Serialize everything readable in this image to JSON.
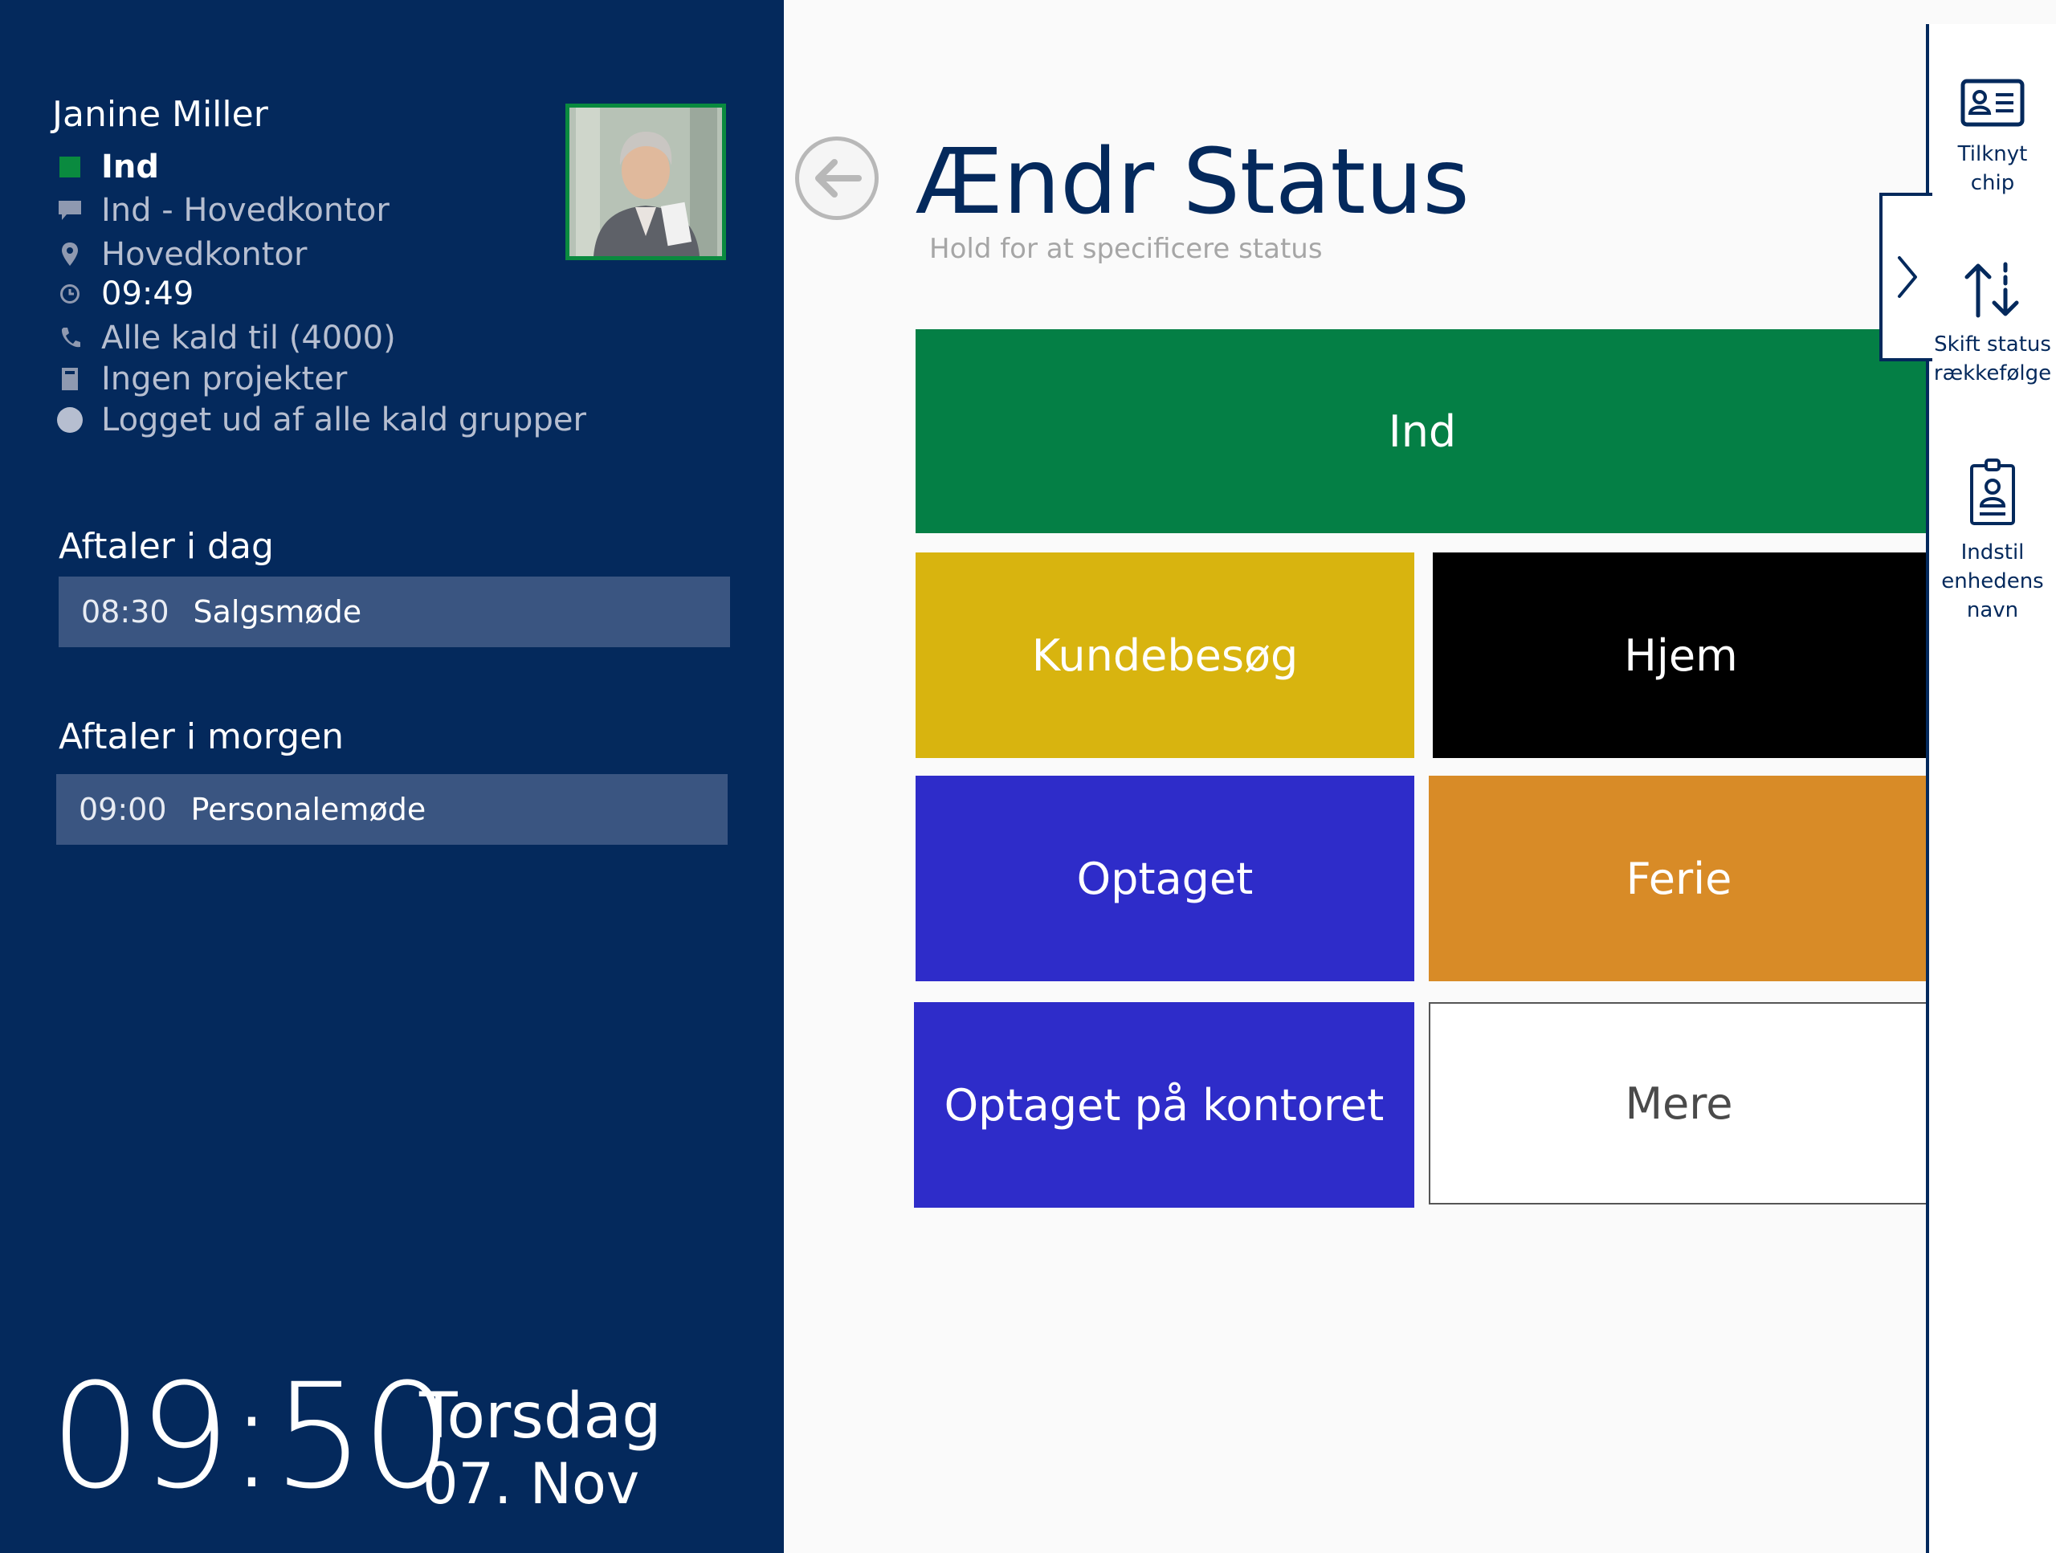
{
  "user": {
    "name": "Janine Miller",
    "status": "Ind",
    "status_color": "#0a8a3f",
    "message": "Ind - Hovedkontor",
    "location": "Hovedkontor",
    "time": "09:49",
    "calls": "Alle kald til (4000)",
    "projects": "Ingen projekter",
    "call_groups": "Logget ud af alle kald grupper"
  },
  "appointments_today": {
    "title": "Aftaler i dag",
    "items": [
      {
        "time": "08:30",
        "label": "Salgsmøde"
      }
    ]
  },
  "appointments_tomorrow": {
    "title": "Aftaler i morgen",
    "items": [
      {
        "time": "09:00",
        "label": "Personalemøde"
      }
    ]
  },
  "clock": {
    "time": "09:50",
    "day": "Torsdag",
    "date": "07. Nov"
  },
  "main": {
    "title": "Ændr Status",
    "subtitle": "Hold for at specificere status",
    "tiles": [
      {
        "label": "Ind",
        "color": "#047f45"
      },
      {
        "label": "Kundebesøg",
        "color": "#d8b40f"
      },
      {
        "label": "Hjem",
        "color": "#000000"
      },
      {
        "label": "Optaget",
        "color": "#2e2cc9"
      },
      {
        "label": "Ferie",
        "color": "#d88b27"
      },
      {
        "label": "Optaget på kontoret",
        "color": "#2e2cc9"
      },
      {
        "label": "Mere",
        "color": "#ffffff"
      }
    ]
  },
  "rail": {
    "items": [
      {
        "label": "Tilknyt\nchip",
        "icon": "id-card-icon"
      },
      {
        "label": "Skift status\nrækkefølge",
        "icon": "sort-arrows-icon"
      },
      {
        "label": "Indstil\nenhedens\nnavn",
        "icon": "clipboard-user-icon"
      }
    ]
  },
  "colors": {
    "panel": "#04295c",
    "accent": "#04295c"
  }
}
